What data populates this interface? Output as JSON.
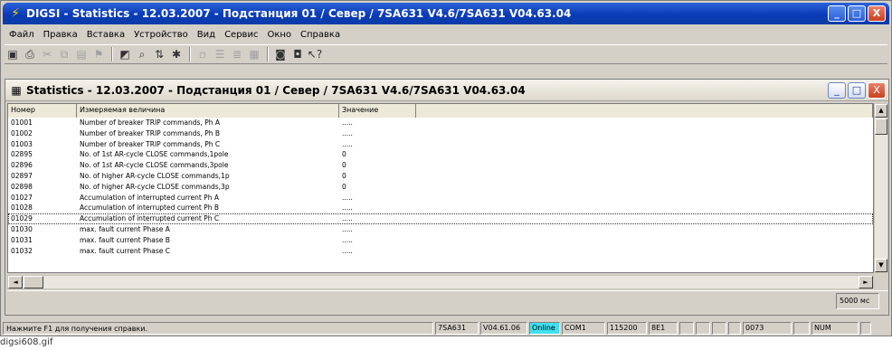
{
  "window": {
    "title": "DIGSI - Statistics - 12.03.2007 - Подстанция 01 / Север / 7SA631 V4.6/7SA631 V04.63.04",
    "icon": "digsi-app-icon",
    "buttons": {
      "minimize": "_",
      "maximize": "□",
      "close": "X"
    }
  },
  "menu": [
    "Файл",
    "Правка",
    "Вставка",
    "Устройство",
    "Вид",
    "Сервис",
    "Окно",
    "Справка"
  ],
  "toolbar": {
    "icons": [
      "save-icon",
      "print-icon",
      "cut-icon",
      "copy-icon",
      "paste-icon",
      "stamp-icon",
      "sep",
      "properties-icon",
      "find-icon",
      "sort-icon",
      "disconnect-icon",
      "sep",
      "small-icons-icon",
      "list-icon",
      "details-icon",
      "grid-icon",
      "sep",
      "device-online-icon",
      "device-offline-icon",
      "help-pointer-icon"
    ],
    "glyphs": {
      "save-icon": "▣",
      "print-icon": "⎙",
      "cut-icon": "✂",
      "copy-icon": "⧉",
      "paste-icon": "▤",
      "stamp-icon": "⚑",
      "properties-icon": "◩",
      "find-icon": "⌕",
      "sort-icon": "⇅",
      "disconnect-icon": "✱",
      "small-icons-icon": "▫",
      "list-icon": "☰",
      "details-icon": "≣",
      "grid-icon": "▦",
      "device-online-icon": "◙",
      "device-offline-icon": "◘",
      "help-pointer-icon": "↖?"
    }
  },
  "child": {
    "title": "Statistics - 12.03.2007 - Подстанция 01 / Север / 7SA631 V4.6/7SA631 V04.63.04",
    "icon": "statistics-icon",
    "columns": [
      "Номер",
      "Измеряемая величина",
      "Значение"
    ],
    "rows": [
      {
        "num": "01001",
        "name": "Number of breaker TRIP commands, Ph A",
        "value": "....."
      },
      {
        "num": "01002",
        "name": "Number of breaker TRIP commands, Ph B",
        "value": "....."
      },
      {
        "num": "01003",
        "name": "Number of breaker TRIP commands, Ph C",
        "value": "....."
      },
      {
        "num": "02895",
        "name": "No. of 1st AR-cycle CLOSE commands,1pole",
        "value": "0"
      },
      {
        "num": "02896",
        "name": "No. of 1st AR-cycle CLOSE commands,3pole",
        "value": "0"
      },
      {
        "num": "02897",
        "name": "No. of higher AR-cycle CLOSE commands,1p",
        "value": "0"
      },
      {
        "num": "02898",
        "name": "No. of higher AR-cycle CLOSE commands,3p",
        "value": "0"
      },
      {
        "num": "01027",
        "name": "Accumulation of interrupted current Ph A",
        "value": "....."
      },
      {
        "num": "01028",
        "name": "Accumulation of interrupted current Ph B",
        "value": "....."
      },
      {
        "num": "01029",
        "name": "Accumulation of interrupted current Ph C",
        "value": ".....",
        "selected": true
      },
      {
        "num": "01030",
        "name": "max. fault current Phase A",
        "value": "....."
      },
      {
        "num": "01031",
        "name": "max. fault current Phase B",
        "value": "....."
      },
      {
        "num": "01032",
        "name": "max. fault current Phase C",
        "value": "....."
      }
    ],
    "refresh_interval": "5000 мс"
  },
  "statusbar": {
    "help_text": "Нажмите F1 для получения справки.",
    "panes": [
      "7SA631",
      "V04.61.06",
      "Online",
      "COM1",
      "115200",
      "8E1",
      "",
      "",
      "",
      "",
      "0073",
      "",
      "NUM",
      ""
    ]
  },
  "caption": "digsi608.gif"
}
